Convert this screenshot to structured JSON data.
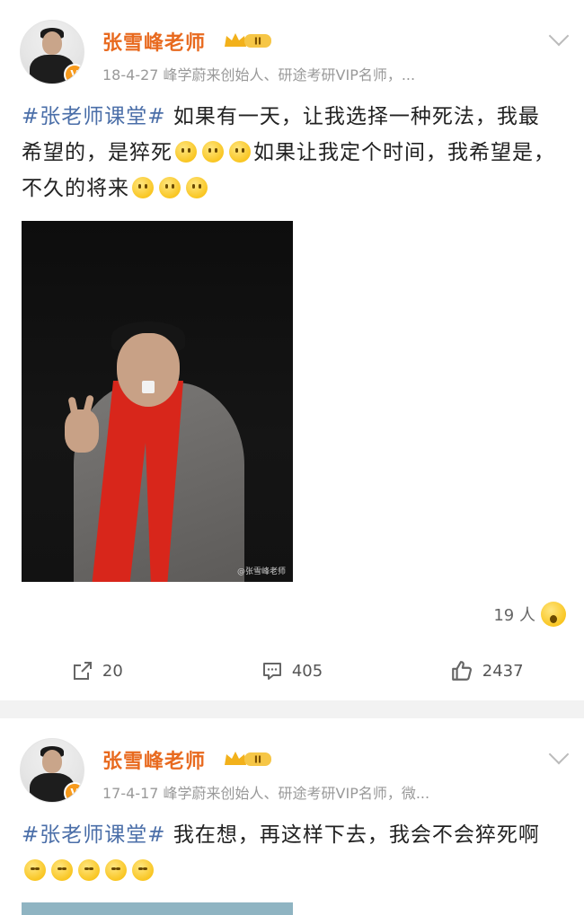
{
  "posts": [
    {
      "author": "张雪峰老师",
      "badge": "II",
      "meta": "18-4-27   峰学蔚来创始人、研途考研VIP名师，...",
      "text_hashtag": "#张老师课堂#",
      "text_part1": " 如果有一天，让我选择一种死法，我最希望的，是猝死",
      "text_part2": "如果让我定个时间，我希望是，不久的将来",
      "image_watermark": "@张雪峰老师",
      "reaction_count": "19 人",
      "repost_count": "20",
      "comment_count": "405",
      "like_count": "2437"
    },
    {
      "author": "张雪峰老师",
      "badge": "II",
      "meta": "17-4-17   峰学蔚来创始人、研途考研VIP名师，微...",
      "text_hashtag": "#张老师课堂#",
      "text_part1": " 我在想，再这样下去，我会不会猝死啊"
    }
  ],
  "colors": {
    "name": "#e86a1f",
    "hashtag": "#4a6ea8",
    "background": "#f2f2f2"
  },
  "icons": [
    "chevron-down-icon",
    "repost-icon",
    "comment-icon",
    "like-icon",
    "vip-crown-icon",
    "verified-v-icon"
  ]
}
